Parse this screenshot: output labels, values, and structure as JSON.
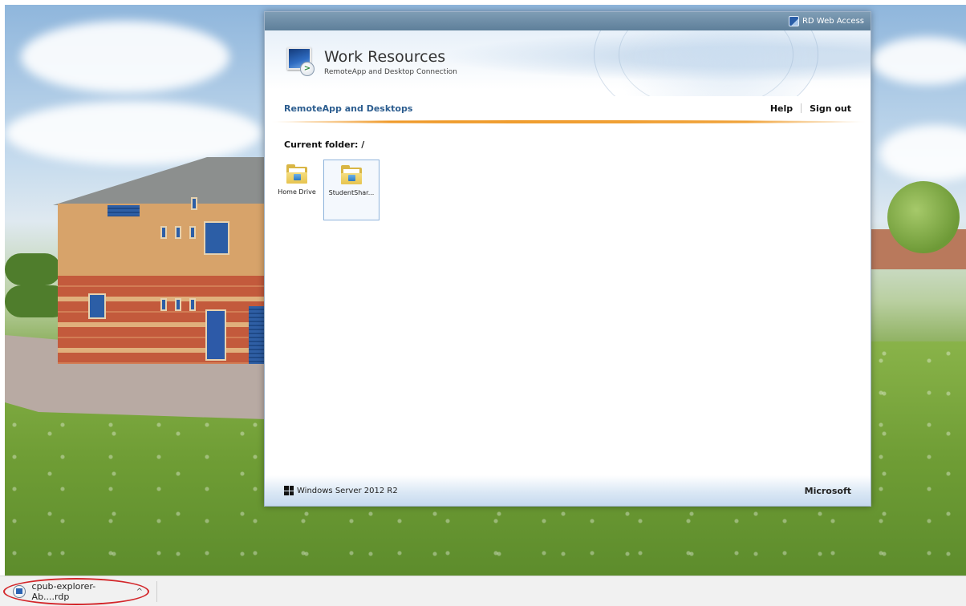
{
  "window": {
    "top_label": "RD Web Access",
    "title": "Work Resources",
    "subtitle": "RemoteApp and Desktop Connection"
  },
  "nav": {
    "tab": "RemoteApp and Desktops",
    "help": "Help",
    "sign_out": "Sign out"
  },
  "content": {
    "current_folder": "Current folder: /",
    "folders": [
      {
        "label": "Home Drive",
        "selected": false,
        "icon": "folder-icon"
      },
      {
        "label": "StudentShar...",
        "selected": true,
        "icon": "folder-icon"
      }
    ]
  },
  "footer": {
    "product": "Windows Server 2012 R2",
    "brand": "Microsoft"
  },
  "downloads": {
    "file_name": "cpub-explorer-Ab....rdp",
    "chevron": "^"
  },
  "colors": {
    "accent_blue": "#2c5d8f",
    "orange_rule": "#ef9a2a",
    "highlight_circle": "#d3262a"
  }
}
